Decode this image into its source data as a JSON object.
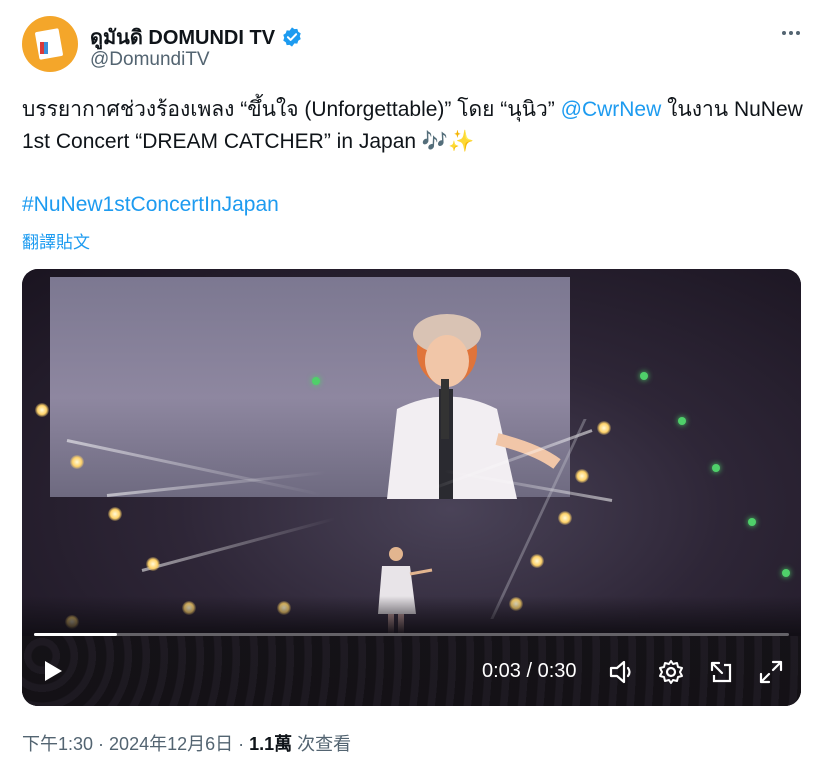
{
  "author": {
    "display_name": "ดูมันดิ DOMUNDI TV",
    "handle": "@DomundiTV",
    "verified": true,
    "avatar_icon": "domundi-logo-icon",
    "avatar_color": "#f4a62a"
  },
  "tweet": {
    "text_part1": "บรรยากาศช่วงร้องเพลง “ขึ้นใจ (Unforgettable)” โดย “นุนิว” ",
    "mention": "@CwrNew",
    "text_part2": " ในงาน NuNew 1st Concert “DREAM CATCHER” in Japan 🎶✨",
    "hashtag": "#NuNew1stConcertInJapan",
    "translate_label": "翻譯貼文"
  },
  "video": {
    "progress": 0.11,
    "time_display": "0:03 / 0:30",
    "icons": [
      "play-icon",
      "volume-icon",
      "settings-icon",
      "pip-icon",
      "fullscreen-icon"
    ]
  },
  "meta": {
    "time": "下午1:30",
    "separator1": " · ",
    "date": "2024年12月6日",
    "separator2": " · ",
    "views_count": "1.1萬",
    "views_label": " 次查看"
  },
  "colors": {
    "link": "#1d9bf0",
    "text": "#0f1419",
    "muted": "#536471"
  }
}
